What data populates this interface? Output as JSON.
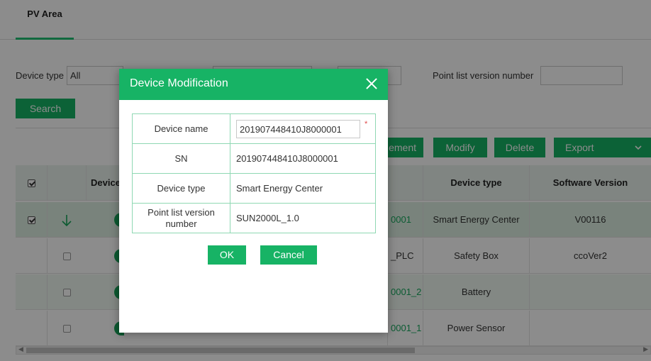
{
  "tabs": {
    "active_label": "PV Area"
  },
  "filters": {
    "device_type_label": "Device type",
    "device_type_value": "All",
    "point_list_label": "Point list version number",
    "point_list_value": "",
    "search_label": "Search"
  },
  "toolbar": {
    "management_label": "ement",
    "modify_label": "Modify",
    "delete_label": "Delete",
    "export_label": "Export"
  },
  "table": {
    "headers": {
      "device": "Device",
      "device_type": "Device type",
      "software_version": "Software Version"
    },
    "rows": [
      {
        "name_fragment": "0001",
        "device_type": "Smart Energy Center",
        "software_version": "V00116"
      },
      {
        "name_fragment": "_PLC",
        "device_type": "Safety Box",
        "software_version": "ccoVer2"
      },
      {
        "name_fragment": "0001_2",
        "device_type": "Battery",
        "software_version": ""
      },
      {
        "name_fragment": "0001_1",
        "device_type": "Power Sensor",
        "software_version": ""
      }
    ]
  },
  "dialog": {
    "title": "Device Modification",
    "fields": [
      {
        "label": "Device name",
        "value": "201907448410J8000001"
      },
      {
        "label": "SN",
        "value": "201907448410J8000001"
      },
      {
        "label": "Device type",
        "value": "Smart Energy Center"
      },
      {
        "label": "Point list version number",
        "value": "SUN2000L_1.0"
      }
    ],
    "required_mark": "*",
    "ok_label": "OK",
    "cancel_label": "Cancel"
  },
  "colors": {
    "accent": "#17b365",
    "overlay": "rgba(0,0,0,0.45)"
  }
}
